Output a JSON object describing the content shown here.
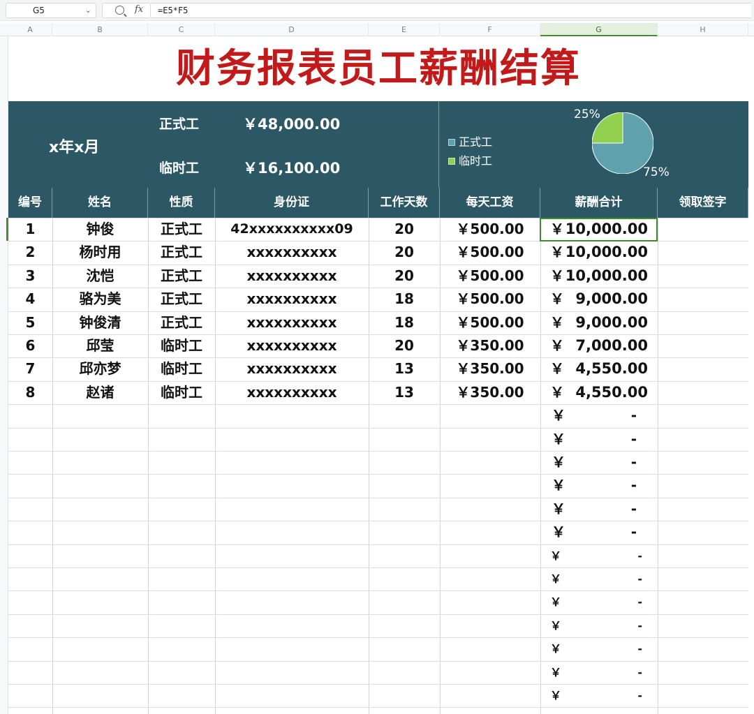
{
  "formula_bar": {
    "cell_ref": "G5",
    "fx_label": "fx",
    "formula": "=E5*F5"
  },
  "columns": [
    "A",
    "B",
    "C",
    "D",
    "E",
    "F",
    "G",
    "H"
  ],
  "sheet": {
    "title": "财务报表员工薪酬结算",
    "period": "x年x月",
    "summary": [
      {
        "label": "正式工",
        "value": "￥48,000.00"
      },
      {
        "label": "临时工",
        "value": "￥16,100.00"
      }
    ],
    "pie": {
      "legend": [
        "正式工",
        "临时工"
      ],
      "pct_small": "25%",
      "pct_large": "75%",
      "colors": {
        "formal": "#5fa1ac",
        "temp": "#92d050",
        "band": "#2c5765"
      }
    },
    "headers": [
      "编号",
      "姓名",
      "性质",
      "身份证",
      "工作天数",
      "每天工资",
      "薪酬合计",
      "领取签字"
    ],
    "rows": [
      {
        "no": "1",
        "name": "钟俊",
        "type": "正式工",
        "id": "42xxxxxxxxxx09",
        "days": "20",
        "rate": "￥500.00",
        "yen": "￥",
        "total": "10,000.00"
      },
      {
        "no": "2",
        "name": "杨时用",
        "type": "正式工",
        "id": "xxxxxxxxxx",
        "days": "20",
        "rate": "￥500.00",
        "yen": "￥",
        "total": "10,000.00"
      },
      {
        "no": "3",
        "name": "沈恺",
        "type": "正式工",
        "id": "xxxxxxxxxx",
        "days": "20",
        "rate": "￥500.00",
        "yen": "￥",
        "total": "10,000.00"
      },
      {
        "no": "4",
        "name": "骆为美",
        "type": "正式工",
        "id": "xxxxxxxxxx",
        "days": "18",
        "rate": "￥500.00",
        "yen": "￥",
        "total": "9,000.00"
      },
      {
        "no": "5",
        "name": "钟俊清",
        "type": "正式工",
        "id": "xxxxxxxxxx",
        "days": "18",
        "rate": "￥500.00",
        "yen": "￥",
        "total": "9,000.00"
      },
      {
        "no": "6",
        "name": "邱莹",
        "type": "临时工",
        "id": "xxxxxxxxxx",
        "days": "20",
        "rate": "￥350.00",
        "yen": "￥",
        "total": "7,000.00"
      },
      {
        "no": "7",
        "name": "邱亦梦",
        "type": "临时工",
        "id": "xxxxxxxxxx",
        "days": "13",
        "rate": "￥350.00",
        "yen": "￥",
        "total": "4,550.00"
      },
      {
        "no": "8",
        "name": "赵诸",
        "type": "临时工",
        "id": "xxxxxxxxxx",
        "days": "13",
        "rate": "￥350.00",
        "yen": "￥",
        "total": "4,550.00"
      }
    ],
    "empty_pay": {
      "yen": "￥",
      "dash": "-",
      "large_count": 6,
      "small_count": 7
    }
  }
}
